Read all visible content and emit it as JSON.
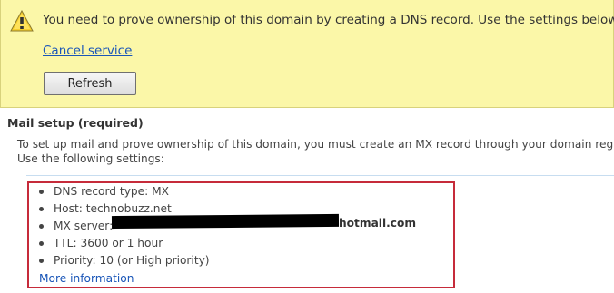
{
  "alert": {
    "message": "You need to prove ownership of this domain by creating a DNS record. Use the settings below.",
    "cancel_link": "Cancel service",
    "refresh_button": "Refresh",
    "icon": "warning-icon",
    "background_color": "#fbf7a8"
  },
  "mail_setup": {
    "title": "Mail setup (required)",
    "intro_line_1": "To set up mail and prove ownership of this domain, you must create an MX record through your domain registra",
    "intro_line_2": "Use the following settings:",
    "settings": [
      "DNS record type: MX",
      "Host: technobuzz.net",
      "MX server: ",
      "TTL: 3600 or 1 hour",
      "Priority: 10 (or High priority)"
    ],
    "mx_server_domain": "hotmail.com",
    "more_information": "More information",
    "highlight_color": "#c62b3a",
    "link_color": "#1a56b8"
  }
}
